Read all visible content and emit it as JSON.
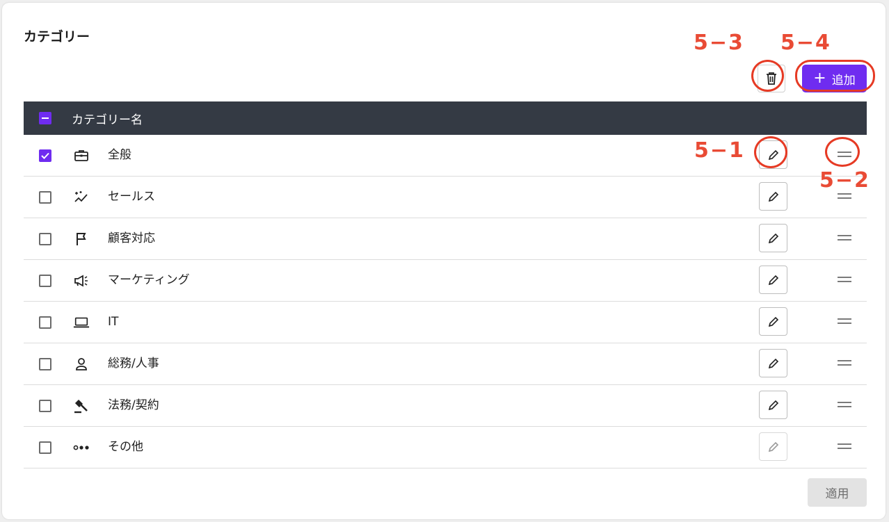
{
  "title": "カテゴリー",
  "toolbar": {
    "trash_icon": "trash-icon",
    "add_label": "追加",
    "add_plus": "+"
  },
  "table": {
    "header": "カテゴリー名",
    "rows": [
      {
        "label": "全般",
        "icon": "briefcase-icon",
        "checked": true,
        "edit_enabled": true
      },
      {
        "label": "セールス",
        "icon": "sparkle-chart-icon",
        "checked": false,
        "edit_enabled": true
      },
      {
        "label": "顧客対応",
        "icon": "flag-icon",
        "checked": false,
        "edit_enabled": true
      },
      {
        "label": "マーケティング",
        "icon": "megaphone-icon",
        "checked": false,
        "edit_enabled": true
      },
      {
        "label": "IT",
        "icon": "laptop-icon",
        "checked": false,
        "edit_enabled": true
      },
      {
        "label": "総務/人事",
        "icon": "person-icon",
        "checked": false,
        "edit_enabled": true
      },
      {
        "label": "法務/契約",
        "icon": "gavel-icon",
        "checked": false,
        "edit_enabled": true
      },
      {
        "label": "その他",
        "icon": "more-dots-icon",
        "checked": false,
        "edit_enabled": false
      }
    ]
  },
  "footer": {
    "apply_label": "適用"
  },
  "annotations": {
    "a1": "5−1",
    "a2": "5−2",
    "a3": "5−3",
    "a4": "5−4"
  },
  "colors": {
    "accent": "#6f2cf0",
    "header_bg": "#343a44",
    "annotation": "#e63a24"
  }
}
